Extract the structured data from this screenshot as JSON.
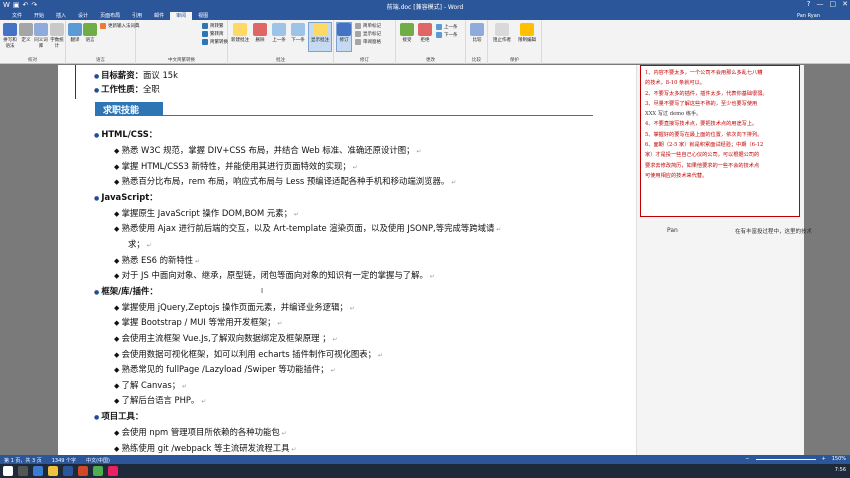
{
  "window": {
    "title": "前端.doc [兼容模式] - Word",
    "user": "Pan Ryan",
    "help": "?",
    "min": "—",
    "max": "□",
    "close": "✕"
  },
  "tabs": [
    "文件",
    "开始",
    "插入",
    "设计",
    "页面布局",
    "引用",
    "邮件",
    "审阅",
    "视图"
  ],
  "active_tab_index": 7,
  "ribbon": {
    "proof": {
      "label": "校对",
      "buttons": [
        "拼写和语法",
        "定义",
        "同义词库",
        "字数统计"
      ]
    },
    "lang": {
      "label": "语言",
      "buttons": [
        "翻译",
        "语言"
      ],
      "smalls": [
        "简转繁",
        "繁转简",
        "简繁转换"
      ]
    },
    "chinese": {
      "label": "中文简繁转换",
      "smalls": [
        "更新输入法词典"
      ]
    },
    "comments": {
      "label": "批注",
      "buttons": [
        "新建批注",
        "删除",
        "上一条",
        "下一条",
        "显示批注"
      ]
    },
    "track": {
      "label": "修订",
      "buttons": [
        "修订"
      ],
      "smalls": [
        "简单标记",
        "显示标记",
        "审阅窗格"
      ]
    },
    "changes": {
      "label": "更改",
      "buttons": [
        "接受",
        "拒绝"
      ],
      "smalls": [
        "上一条",
        "下一条"
      ]
    },
    "compare": {
      "label": "比较",
      "buttons": [
        "比较"
      ]
    },
    "protect": {
      "label": "保护",
      "buttons": [
        "阻止作者",
        "限制编辑"
      ]
    }
  },
  "doc": {
    "top_lines": [
      {
        "label": "目标薪资",
        "value": "面议 15k"
      },
      {
        "label": "工作性质",
        "value": "全职"
      }
    ],
    "section_title": "求职技能",
    "skills": [
      {
        "title": "HTML/CSS：",
        "items": [
          "熟悉 W3C 规范，掌握 DIV+CSS 布局，并结合 Web 标准、准确还原设计图；",
          "掌握 HTML/CSS3 新特性，并能使用其进行页面特效的实现；",
          "熟悉百分比布局，rem 布局，响应式布局与 Less 预编译适配各种手机和移动端浏览器。"
        ]
      },
      {
        "title": "JavaScript：",
        "items": [
          "掌握原生 JavaScript 操作 DOM,BOM  元素；",
          "熟悉使用 Ajax 进行前后端的交互，以及 Art-template 渲染页面，以及使用 JSONP,等完成等跨域请",
          "求；",
          "熟悉 ES6 的新特性",
          "对于 JS 中面向对象、继承，原型链，闭包等面向对象的知识有一定的掌握与了解。"
        ]
      },
      {
        "title": "框架/库/插件：",
        "items": [
          "掌握使用 jQuery,Zeptojs 操作页面元素，并编译业务逻辑；",
          "掌握 Bootstrap / MUI  等常用开发框架；",
          "会使用主流框架 Vue.Js,了解双向数据绑定及框架原理 ；",
          "会使用数据可视化框架，如可以利用 echarts 插件制作可视化图表；",
          "熟悉常见的 fullPage /Lazyload /Swiper 等功能插件；",
          "了解 Canvas；",
          "了解后台语言 PHP。"
        ]
      },
      {
        "title": "项目工具：",
        "items": [
          "会使用 npm  管理项目所依赖的各种功能包",
          "熟练使用 git /webpack  等主流研发流程工具"
        ]
      }
    ]
  },
  "comment": {
    "lines": [
      {
        "text": "1、内容不要太多，一个公司不会用那么多乱七八糟",
        "dark": false
      },
      {
        "text": "的技术，8-10 条就可以。",
        "dark": false
      },
      {
        "text": "2、不要写太多的插件，插件太多，代表你基础很弱。",
        "dark": false
      },
      {
        "text": "3、尽量不要写了解这些不熟的，至少也要写使用",
        "dark": false
      },
      {
        "text": "XXX 写过 demo 练手。",
        "dark": true
      },
      {
        "text": "4、不要直接写技术点，要把技术点的用途写上。",
        "dark": false
      },
      {
        "text": "5、掌握好的要写在最上面的位置，依次向下排列。",
        "dark": false
      },
      {
        "text": "6、面期（2-5 家）就是积累面试经验；中期（6-12",
        "dark": false
      },
      {
        "text": "家）才是投一些自己心仪的公司，可以根据公司的",
        "dark": false
      },
      {
        "text": "要求去修改简历，如果他要求的一些不会的技术点",
        "dark": false
      },
      {
        "text": "可使用相应的技术来代替。",
        "dark": false
      }
    ],
    "author": "Pan",
    "reply": "在有丰富投过程中，这里的技术"
  },
  "status": {
    "page": "第 1 页，共 3 页",
    "words": "1349 个字",
    "lang": "中文(中国)",
    "zoom": "150%"
  },
  "clock": "7:56"
}
